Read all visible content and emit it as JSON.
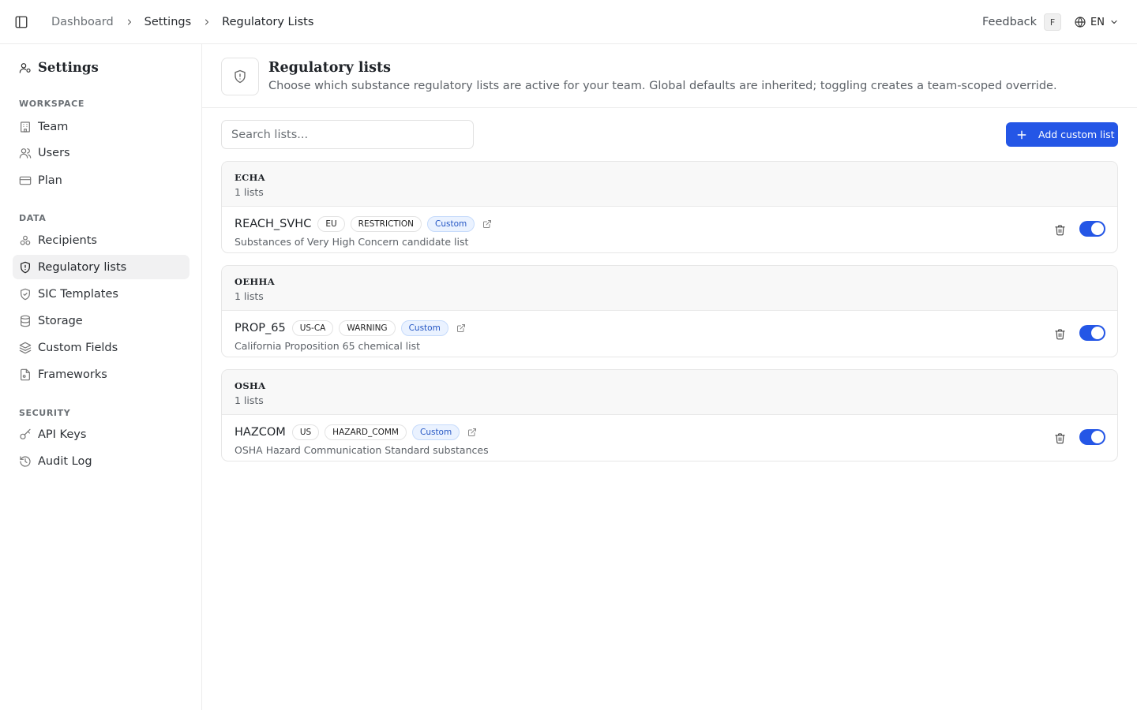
{
  "topbar": {
    "breadcrumb": [
      "Dashboard",
      "Settings",
      "Regulatory Lists"
    ],
    "feedback_label": "Feedback",
    "feedback_shortcut": "F",
    "language": "EN"
  },
  "sidebar": {
    "title": "Settings",
    "sections": [
      {
        "label": "WORKSPACE",
        "items": [
          {
            "label": "Team",
            "icon": "building-icon"
          },
          {
            "label": "Users",
            "icon": "users-icon"
          },
          {
            "label": "Plan",
            "icon": "credit-card-icon"
          }
        ]
      },
      {
        "label": "DATA",
        "items": [
          {
            "label": "Recipients",
            "icon": "recipients-icon"
          },
          {
            "label": "Regulatory lists",
            "icon": "shield-alert-icon",
            "active": true
          },
          {
            "label": "SIC Templates",
            "icon": "shield-check-icon"
          },
          {
            "label": "Storage",
            "icon": "database-icon"
          },
          {
            "label": "Custom Fields",
            "icon": "layers-icon"
          },
          {
            "label": "Frameworks",
            "icon": "file-icon"
          }
        ]
      },
      {
        "label": "SECURITY",
        "items": [
          {
            "label": "API Keys",
            "icon": "key-icon"
          },
          {
            "label": "Audit Log",
            "icon": "history-icon"
          }
        ]
      }
    ]
  },
  "header": {
    "title": "Regulatory lists",
    "description": "Choose which substance regulatory lists are active for your team. Global defaults are inherited; toggling creates a team-scoped override."
  },
  "toolbar": {
    "search_placeholder": "Search lists...",
    "add_label": "Add custom list"
  },
  "groups": [
    {
      "name": "ECHA",
      "count_label": "1 lists",
      "items": [
        {
          "name": "REACH_SVHC",
          "tags": [
            "EU",
            "RESTRICTION"
          ],
          "badge": "Custom",
          "description": "Substances of Very High Concern candidate list",
          "enabled": true
        }
      ]
    },
    {
      "name": "OEHHA",
      "count_label": "1 lists",
      "items": [
        {
          "name": "PROP_65",
          "tags": [
            "US-CA",
            "WARNING"
          ],
          "badge": "Custom",
          "description": "California Proposition 65 chemical list",
          "enabled": true
        }
      ]
    },
    {
      "name": "OSHA",
      "count_label": "1 lists",
      "items": [
        {
          "name": "HAZCOM",
          "tags": [
            "US",
            "HAZARD_COMM"
          ],
          "badge": "Custom",
          "description": "OSHA Hazard Communication Standard substances",
          "enabled": true
        }
      ]
    }
  ],
  "colors": {
    "accent": "#2456e6",
    "badge_bg": "#eaf2ff",
    "badge_text": "#2456c4"
  }
}
